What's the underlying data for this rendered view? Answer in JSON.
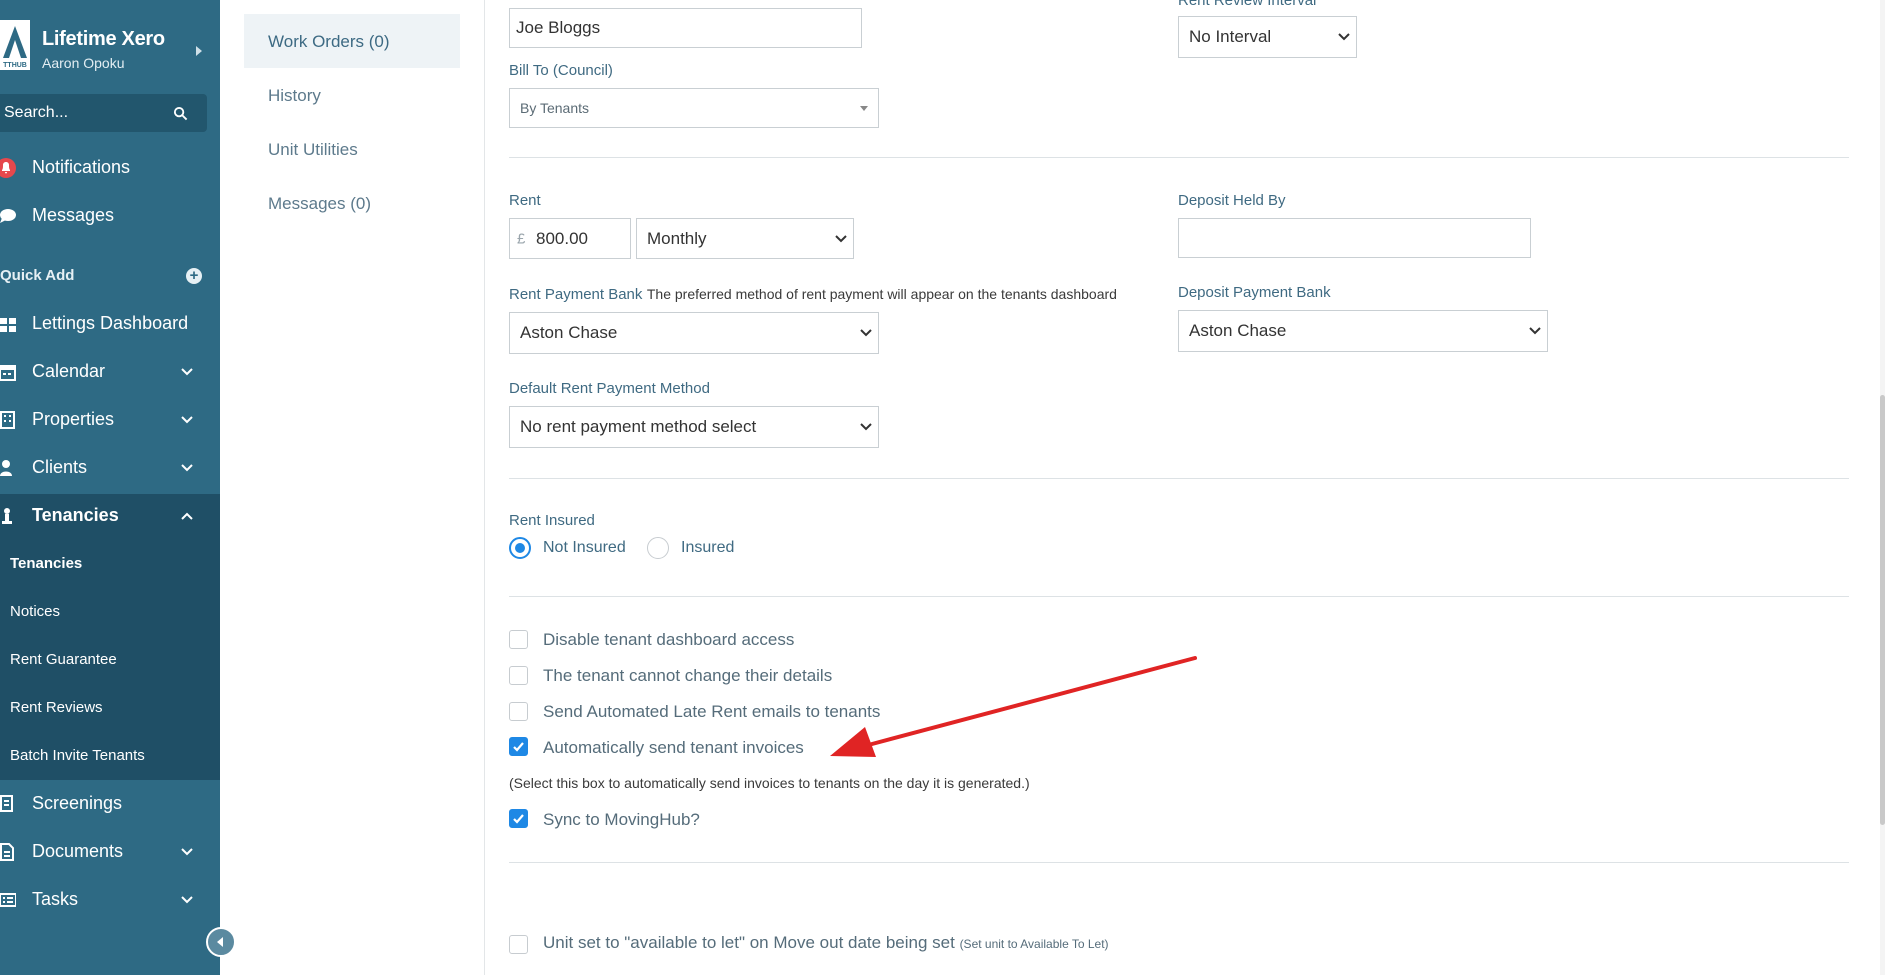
{
  "sidebar": {
    "brand_title": "Lifetime Xero",
    "brand_user": "Aaron Opoku",
    "logo_text": "TTHUB",
    "search_placeholder": "Search...",
    "notifications": "Notifications",
    "messages": "Messages",
    "quick_add": "Quick Add",
    "lettings_dashboard": "Lettings Dashboard",
    "calendar": "Calendar",
    "properties": "Properties",
    "clients": "Clients",
    "tenancies": "Tenancies",
    "sub_tenancies": "Tenancies",
    "sub_notices": "Notices",
    "sub_rent_guarantee": "Rent Guarantee",
    "sub_rent_reviews": "Rent Reviews",
    "sub_batch_invite": "Batch Invite Tenants",
    "screenings": "Screenings",
    "documents": "Documents",
    "tasks": "Tasks"
  },
  "subnav": {
    "work_orders": "Work Orders (0)",
    "history": "History",
    "unit_utilities": "Unit Utilities",
    "messages": "Messages (0)"
  },
  "form": {
    "name_value": "Joe  Bloggs",
    "rent_review_interval_label": "Rent Review Interval",
    "rent_review_interval_value": "No Interval",
    "bill_to_label": "Bill To (Council)",
    "bill_to_value": "By Tenants",
    "rent_label": "Rent",
    "currency_symbol": "£",
    "rent_amount": "800.00",
    "rent_frequency": "Monthly",
    "deposit_held_by_label": "Deposit Held By",
    "deposit_held_by_value": "",
    "rent_payment_bank_label": "Rent Payment Bank",
    "rent_payment_bank_help": "The preferred method of rent payment will appear on the tenants dashboard",
    "rent_payment_bank_value": "Aston Chase",
    "deposit_payment_bank_label": "Deposit Payment Bank",
    "deposit_payment_bank_value": "Aston Chase",
    "default_rent_method_label": "Default Rent Payment Method",
    "default_rent_method_value": "No rent payment method select",
    "rent_insured_label": "Rent Insured",
    "not_insured": "Not Insured",
    "insured": "Insured",
    "cb_disable_dashboard": "Disable tenant dashboard access",
    "cb_cannot_change": "The tenant cannot change their details",
    "cb_late_rent": "Send Automated Late Rent emails to tenants",
    "cb_auto_invoices": "Automatically send tenant invoices",
    "auto_invoices_help": "(Select this box to automatically send invoices to tenants on the day it is generated.)",
    "cb_sync": "Sync to MovingHub?",
    "cb_available_to_let": "Unit set to \"available to let\" on Move out date being set",
    "cb_available_to_let_note": "(Set unit to Available To Let)"
  },
  "states": {
    "not_insured_selected": true,
    "disable_dashboard": false,
    "cannot_change": false,
    "late_rent": false,
    "auto_invoices": true,
    "sync": true,
    "available_to_let": false
  },
  "colors": {
    "sidebar_bg": "#2e6a84",
    "sidebar_active_bg": "#1f4f66",
    "accent_blue": "#1e88e5",
    "annotation_arrow": "#e02424",
    "notification_red": "#e5484d"
  },
  "annotation": {
    "type": "arrow",
    "points_to": "cb_auto_invoices"
  }
}
